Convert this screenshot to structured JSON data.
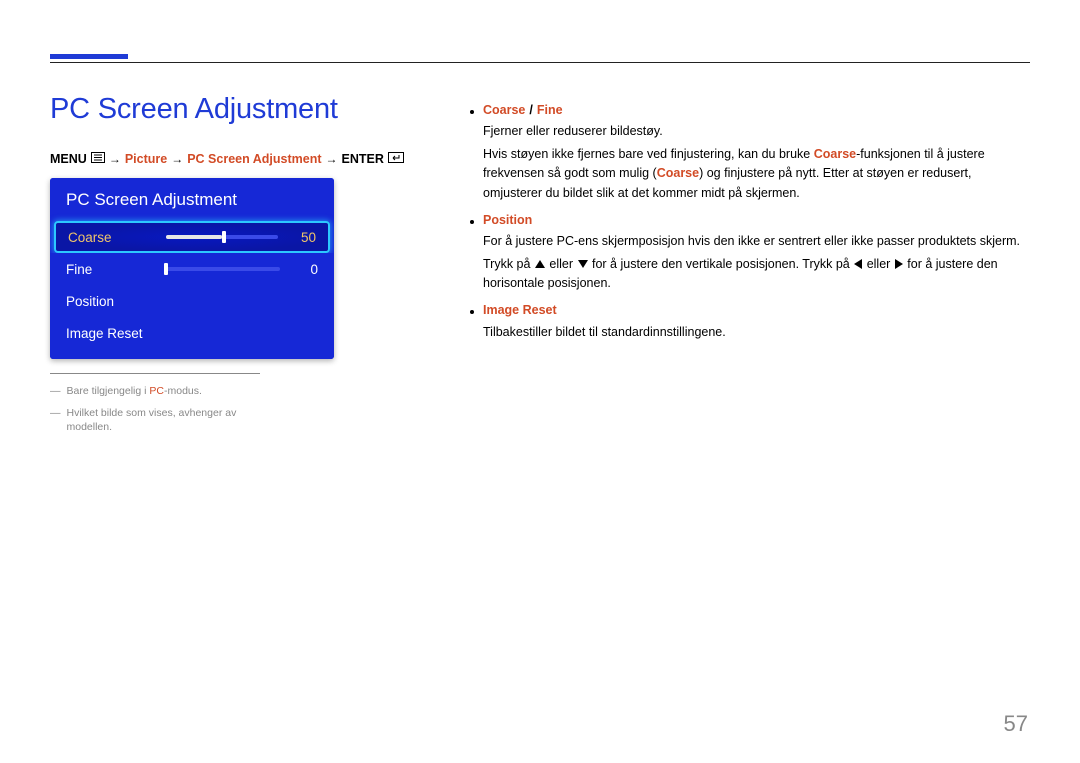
{
  "heading": "PC Screen Adjustment",
  "breadcrumb": {
    "menu": "MENU",
    "picture": "Picture",
    "pcscreen": "PC Screen Adjustment",
    "enter": "ENTER"
  },
  "osd": {
    "title": "PC Screen Adjustment",
    "rows": [
      {
        "label": "Coarse",
        "value": "50",
        "percent": 50,
        "selected": true,
        "slider": true
      },
      {
        "label": "Fine",
        "value": "0",
        "percent": 0,
        "selected": false,
        "slider": true
      },
      {
        "label": "Position",
        "value": "",
        "percent": null,
        "selected": false,
        "slider": false
      },
      {
        "label": "Image Reset",
        "value": "",
        "percent": null,
        "selected": false,
        "slider": false
      }
    ]
  },
  "footnotes": {
    "f1_a": "Bare tilgjengelig i ",
    "f1_pc": "PC",
    "f1_b": "-modus.",
    "f2": "Hvilket bilde som vises, avhenger av modellen."
  },
  "bullets": {
    "coarsefine": {
      "t1": "Coarse",
      "slash": "/",
      "t2": "Fine",
      "p1": "Fjerner eller reduserer bildestøy.",
      "p2a": "Hvis støyen ikke fjernes bare ved finjustering, kan du bruke ",
      "p2b": "Coarse",
      "p2c": "-funksjonen til å justere frekvensen så godt som mulig (",
      "p2d": "Coarse",
      "p2e": ") og finjustere på nytt. Etter at støyen er redusert, omjusterer du bildet slik at det kommer midt på skjermen."
    },
    "position": {
      "t": "Position",
      "p1": "For å justere PC-ens skjermposisjon hvis den ikke er sentrert eller ikke passer produktets skjerm.",
      "p2a": "Trykk på ",
      "p2b": " eller ",
      "p2c": " for å justere den vertikale posisjonen. Trykk på ",
      "p2d": " eller ",
      "p2e": " for å justere den horisontale posisjonen."
    },
    "imageReset": {
      "t": "Image Reset",
      "p1": "Tilbakestiller bildet til standardinnstillingene."
    }
  },
  "pageNumber": "57"
}
